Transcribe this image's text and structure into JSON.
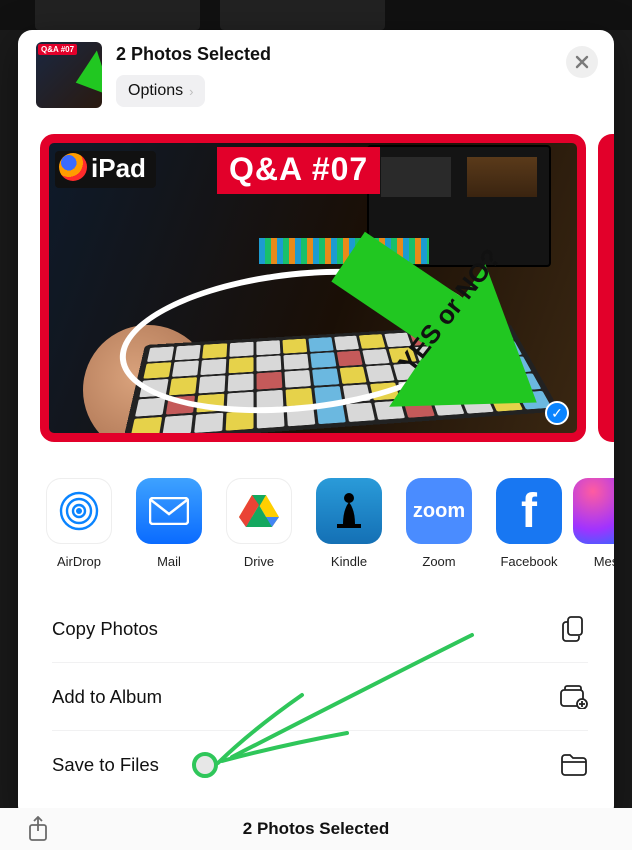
{
  "header": {
    "title": "2 Photos Selected",
    "options_label": "Options",
    "thumb_badge": "Q&A #07"
  },
  "preview": {
    "badge_ipad": "iPad",
    "badge_qa": "Q&A #07",
    "arrow_text": "YES or NO?"
  },
  "apps": [
    {
      "id": "airdrop",
      "label": "AirDrop"
    },
    {
      "id": "mail",
      "label": "Mail"
    },
    {
      "id": "drive",
      "label": "Drive"
    },
    {
      "id": "kindle",
      "label": "Kindle"
    },
    {
      "id": "zoom",
      "label": "Zoom"
    },
    {
      "id": "facebook",
      "label": "Facebook"
    },
    {
      "id": "messenger",
      "label": "Mes"
    }
  ],
  "actions": {
    "copy": "Copy Photos",
    "album": "Add to Album",
    "files": "Save to Files"
  },
  "footer": {
    "selected": "2 Photos Selected"
  }
}
